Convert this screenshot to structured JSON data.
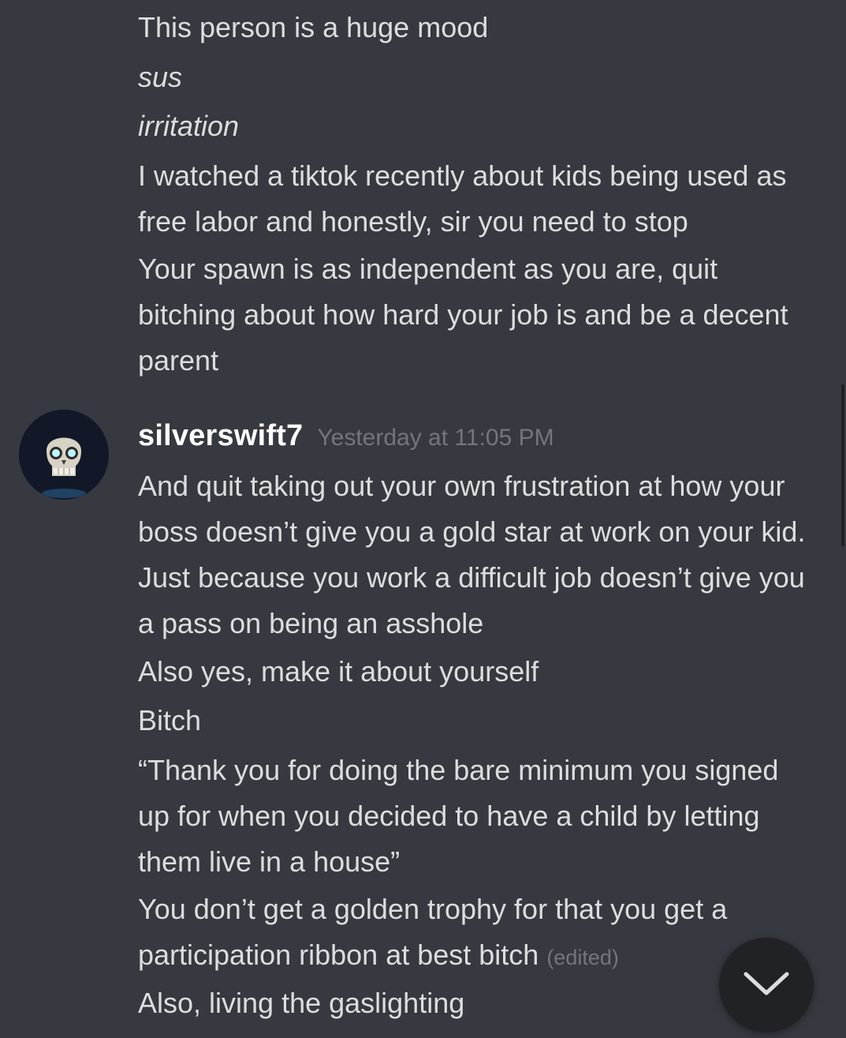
{
  "messages_before": [
    {
      "text": "This person is a huge mood",
      "italic": false
    },
    {
      "text": "sus",
      "italic": true
    },
    {
      "text": "irritation",
      "italic": true
    },
    {
      "text": "I watched a tiktok recently about kids being used as free labor and honestly, sir you need to stop",
      "italic": false
    },
    {
      "text": "Your spawn is as independent as you are, quit bitching about how hard your job is and be a decent parent",
      "italic": false
    }
  ],
  "group": {
    "username": "silverswift7",
    "timestamp": "Yesterday at 11:05 PM",
    "avatar_icon": "skull-avatar-icon",
    "messages": [
      {
        "text": "And quit taking out your own frustration at how your boss doesn’t give you a gold star at work on your kid. Just because you work a difficult job doesn’t give you a pass on being an asshole"
      },
      {
        "text": "Also yes, make it about yourself"
      },
      {
        "text": "Bitch"
      },
      {
        "text": "“Thank you for doing the bare minimum you signed up for when you decided to have a child by letting them live in a house”"
      },
      {
        "text": "You don’t get a golden trophy for that you get a participation ribbon at best bitch",
        "edited_label": "(edited)"
      },
      {
        "text": "Also, living the gaslighting"
      }
    ]
  },
  "jump_button": {
    "icon": "chevron-down-icon"
  },
  "colors": {
    "background": "#36393f",
    "text": "#dcddde",
    "username": "#ffffff",
    "muted": "#72767d",
    "button": "#202225"
  }
}
